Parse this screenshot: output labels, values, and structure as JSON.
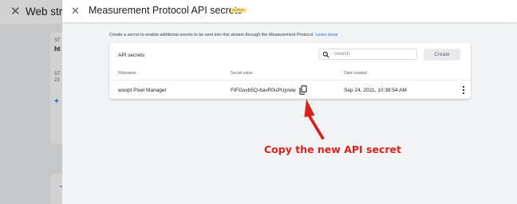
{
  "background": {
    "close_icon": "close-icon",
    "title": "Web strea",
    "card": {
      "label_1": "ST",
      "value_1": "ht",
      "label_2": "ST",
      "value_2": "23"
    }
  },
  "dialog": {
    "close_icon": "close-icon",
    "title": "Measurement Protocol API secrets",
    "badge": "ALPHA",
    "description": "Create a secret to enable additional events to be sent into this stream through the Measurement Protocol.",
    "learn_more": "Learn more",
    "card": {
      "title": "API secrets",
      "search": {
        "placeholder": "Search",
        "value": ""
      },
      "create_label": "Create",
      "columns": [
        "Nickname",
        "Secret value",
        "Date created"
      ],
      "rows": [
        {
          "nickname": "woopt Pixel Manager",
          "secret": "FIFGuvb5Q-6avR0uPUjvww",
          "date": "Sep 24, 2021, 10:39:54 AM"
        }
      ]
    }
  },
  "annotation": {
    "text": "Copy the new API secret",
    "color": "#d9211d"
  },
  "colors": {
    "accent": "#1a73e8",
    "alpha_badge": "#fde293",
    "overlay_bg": "#f1f3f4"
  }
}
